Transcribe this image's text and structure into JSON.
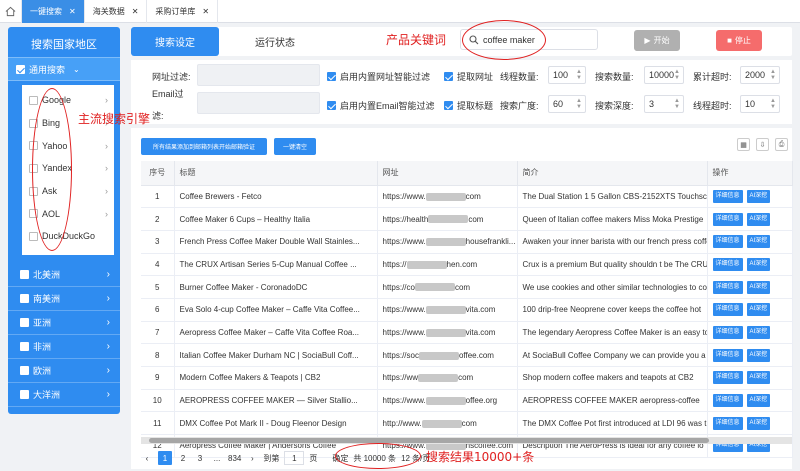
{
  "tabs": [
    {
      "label": "一键搜索"
    },
    {
      "label": "海关数据"
    },
    {
      "label": "采购订单库"
    }
  ],
  "sidebar": {
    "title": "搜索国家地区",
    "main_label": "通用搜索",
    "engines": [
      {
        "label": "Google"
      },
      {
        "label": "Bing"
      },
      {
        "label": "Yahoo"
      },
      {
        "label": "Yandex"
      },
      {
        "label": "Ask"
      },
      {
        "label": "AOL"
      },
      {
        "label": "DuckDuckGo"
      }
    ],
    "regions": [
      {
        "label": "北美洲"
      },
      {
        "label": "南美洲"
      },
      {
        "label": "亚洲"
      },
      {
        "label": "非洲"
      },
      {
        "label": "欧洲"
      },
      {
        "label": "大洋洲"
      }
    ]
  },
  "toolbar": {
    "tab_search": "搜索设定",
    "tab_status": "运行状态",
    "keyword": "coffee maker",
    "start": "开始",
    "stop": "停止"
  },
  "settings": {
    "url_filter_label": "网址过滤:",
    "email_filter_label_1": "Email过",
    "email_filter_label_2": "滤:",
    "cb_url_filter": "启用内置网址智能过滤",
    "cb_email_filter": "启用内置Email智能过滤",
    "cb_fetch_url": "提取网址",
    "cb_fetch_title": "提取标题",
    "thread_count_label": "线程数量:",
    "thread_count": "100",
    "search_count_label": "搜索数量:",
    "search_count": "10000",
    "total_timeout_label": "累计超时:",
    "total_timeout": "2000",
    "search_breadth_label": "搜索广度:",
    "search_breadth": "60",
    "search_depth_label": "搜索深度:",
    "search_depth": "3",
    "thread_timeout_label": "线程超时:",
    "thread_timeout": "10"
  },
  "grid": {
    "btn_verify": "所有结果添加到邮箱列表开始邮箱验证",
    "btn_clear": "一键清空",
    "headers": {
      "no": "序号",
      "title": "标题",
      "url": "网址",
      "desc": "简介",
      "action": "操作"
    },
    "detail_label": "详细信息",
    "ai_label": "AI深挖",
    "rows": [
      {
        "no": "1",
        "title": "Coffee Brewers - Fetco",
        "url_a": "https://www.",
        "url_b": "com",
        "desc": "The Dual Station 1 5 Gallon CBS-2152XTS Touchscre"
      },
      {
        "no": "2",
        "title": "Coffee Maker 6 Cups – Healthy Italia",
        "url_a": "https://health",
        "url_b": "com",
        "desc": "Queen of Italian coffee makers Miss Moka Prestige"
      },
      {
        "no": "3",
        "title": "French Press Coffee Maker Double Wall Stainles...",
        "url_a": "https://www.",
        "url_b": "housefrankli...",
        "desc": "Awaken your inner barista with our french press coffee"
      },
      {
        "no": "4",
        "title": "The CRUX Artisan Series 5-Cup Manual Coffee ...",
        "url_a": "https://",
        "url_b": "hen.com",
        "desc": "Crux is a premium But quality shouldn t be The CRUX"
      },
      {
        "no": "5",
        "title": "Burner Coffee Maker - CoronadoDC",
        "url_a": "https://co",
        "url_b": "com",
        "desc": "We use cookies and other similar technologies to coll"
      },
      {
        "no": "6",
        "title": "Eva Solo 4-cup Coffee Maker – Caffe Vita Coffee...",
        "url_a": "https://www.",
        "url_b": "vita.com",
        "desc": "100 drip-free Neoprene cover keeps the coffee hot"
      },
      {
        "no": "7",
        "title": "Aeropress Coffee Maker – Caffe Vita Coffee Roa...",
        "url_a": "https://www.",
        "url_b": "vita.com",
        "desc": "The legendary Aeropress Coffee Maker is an easy to"
      },
      {
        "no": "8",
        "title": "Italian Coffee Maker Durham NC | SociaBull Coff...",
        "url_a": "https://soc",
        "url_b": "offee.com",
        "desc": "At SociaBull Coffee Company we can provide you a"
      },
      {
        "no": "9",
        "title": "Modern Coffee Makers & Teapots | CB2",
        "url_a": "https://ww",
        "url_b": "com",
        "desc": "Shop modern coffee makers and teapots at CB2"
      },
      {
        "no": "10",
        "title": "AEROPRESS COFFEE MAKER — Silver Stallio...",
        "url_a": "https://www.",
        "url_b": "offee.org",
        "desc": "AEROPRESS COFFEE MAKER aeropress-coffee"
      },
      {
        "no": "11",
        "title": "DMX Coffee Pot Mark II - Doug Fleenor Design",
        "url_a": "http://www.",
        "url_b": "com",
        "desc": "The DMX Coffee Pot first introduced at LDI 96 was the"
      },
      {
        "no": "12",
        "title": "Aeropress Coffee Maker | Andersons Coffee",
        "url_a": "https://www.",
        "url_b": "nscoffee.com",
        "desc": "Description The AeroPress is ideal for any coffee lo"
      }
    ]
  },
  "pager": {
    "p1": "1",
    "p2": "2",
    "p3": "3",
    "dots": "...",
    "last": "834",
    "goto": "到第",
    "page": "1",
    "page_unit": "页",
    "confirm": "确定",
    "total": "共 10000 条",
    "per_page": "12 条/页"
  },
  "annotations": {
    "keyword": "产品关键词",
    "engines": "主流搜索引擎",
    "results": "搜索结果10000+条"
  }
}
